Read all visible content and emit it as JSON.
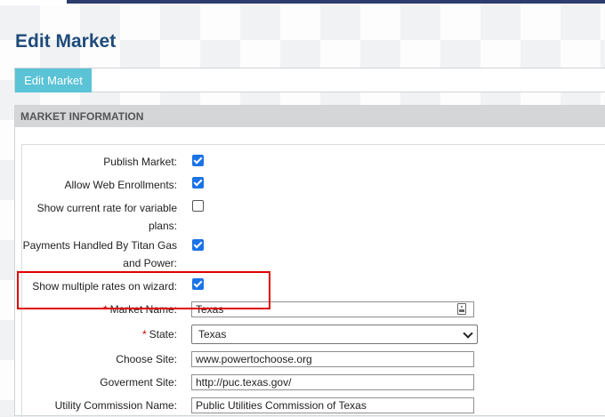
{
  "page": {
    "title": "Edit Market"
  },
  "tabs": [
    {
      "label": "Edit Market",
      "active": true
    }
  ],
  "section": {
    "header": "MARKET INFORMATION"
  },
  "fields": {
    "publish_market": {
      "label": "Publish Market:",
      "checked": true
    },
    "allow_web_enrollments": {
      "label": "Allow Web Enrollments:",
      "checked": true
    },
    "show_current_rate": {
      "label_line1": "Show current rate for variable",
      "label_line2": "plans:",
      "checked": false
    },
    "payments_handled": {
      "label_line1": "Payments Handled By Titan Gas",
      "label_line2": "and Power:",
      "checked": true
    },
    "show_multiple_rates": {
      "label": "Show multiple rates on wizard:",
      "checked": true
    },
    "market_name": {
      "label": "Market Name:",
      "required_mark": "*",
      "value": "Texas"
    },
    "state": {
      "label": "State:",
      "required_mark": "*",
      "value": "Texas"
    },
    "choose_site": {
      "label": "Choose Site:",
      "value": "www.powertochoose.org"
    },
    "government_site": {
      "label": "Goverment Site:",
      "value": "http://puc.texas.gov/"
    },
    "utility_commission_name": {
      "label": "Utility Commission Name:",
      "value": "Public Utilities Commission of Texas"
    }
  },
  "colors": {
    "title": "#1f4b7a",
    "tab_active": "#5bc3d6",
    "checkbox": "#1a73e8",
    "highlight": "#e00000",
    "required": "#cc0000"
  }
}
